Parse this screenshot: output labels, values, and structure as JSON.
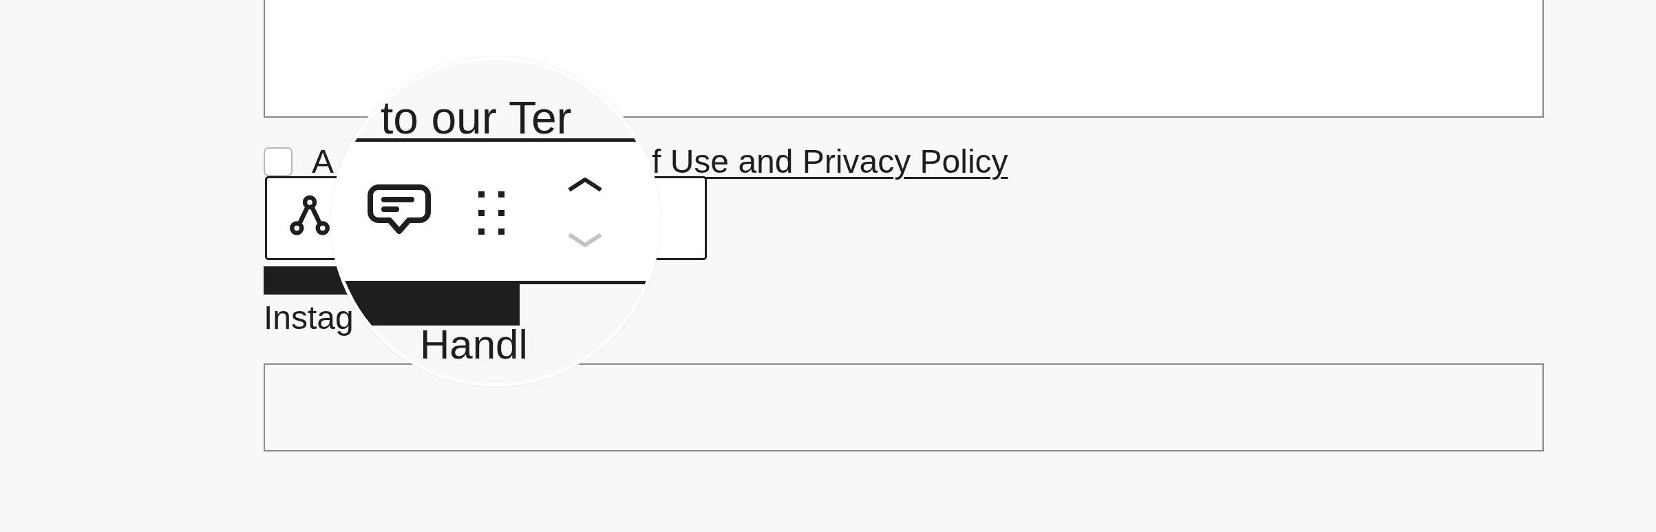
{
  "consent": {
    "checked": false,
    "label_start": "A",
    "link_end": "f Use and Privacy Policy"
  },
  "field_label": "Instag",
  "toolbar": {
    "move_down_disabled": true
  },
  "magnifier": {
    "top_text": "to our Ter",
    "bottom_text": "Handl"
  }
}
